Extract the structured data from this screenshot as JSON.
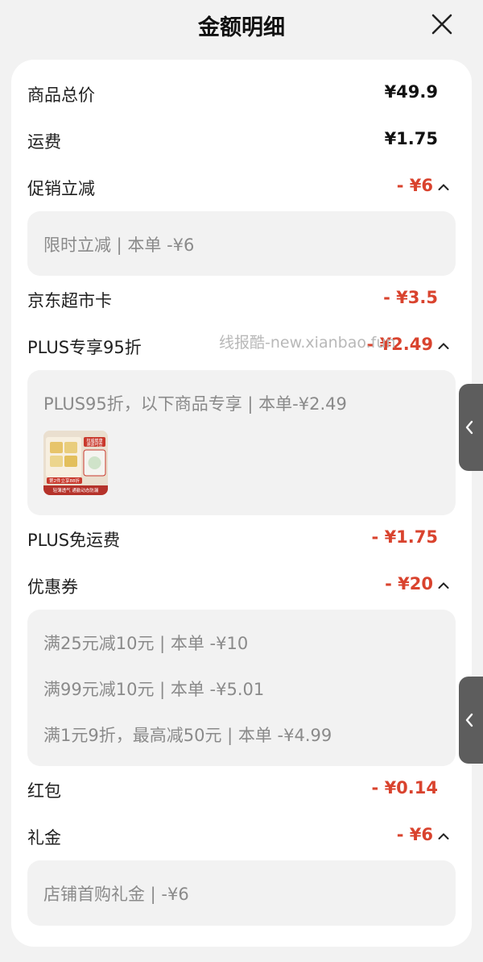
{
  "header": {
    "title": "金额明细",
    "close_icon": "close-icon"
  },
  "rows": {
    "goods_total": {
      "label": "商品总价",
      "amount": "¥49.9"
    },
    "shipping": {
      "label": "运费",
      "amount": "¥1.75"
    },
    "promo": {
      "label": "促销立减",
      "amount": "- ¥6"
    },
    "jd_card": {
      "label": "京东超市卡",
      "amount": "- ¥3.5"
    },
    "plus95": {
      "label": "PLUS专享95折",
      "amount": "- ¥2.49"
    },
    "plus_free_ship": {
      "label": "PLUS免运费",
      "amount": "- ¥1.75"
    },
    "coupon": {
      "label": "优惠券",
      "amount": "- ¥20"
    },
    "red_packet": {
      "label": "红包",
      "amount": "- ¥0.14"
    },
    "gift": {
      "label": "礼金",
      "amount": "- ¥6"
    }
  },
  "panels": {
    "promo": [
      "限时立减 | 本单 -¥6"
    ],
    "plus95": [
      "PLUS95折，以下商品专享 | 本单-¥2.49"
    ],
    "coupon": [
      "满25元减10元 | 本单 -¥10",
      "满99元减10元 | 本单 -¥5.01",
      "满1元9折，最高减50元 | 本单 -¥4.99"
    ],
    "gift": [
      "店铺首购礼金 | -¥6"
    ]
  },
  "product_thumb": {
    "title": "权威健康 溯源可查",
    "promo": "第2件立享88折",
    "subtitle": "轻薄透气 通勤动态防漏"
  },
  "watermark": "线报酷-new.xianbao.fun",
  "colors": {
    "discount_red": "#d9432e",
    "panel_bg": "#f2f2f2",
    "side_tab": "#5d5d5d"
  }
}
